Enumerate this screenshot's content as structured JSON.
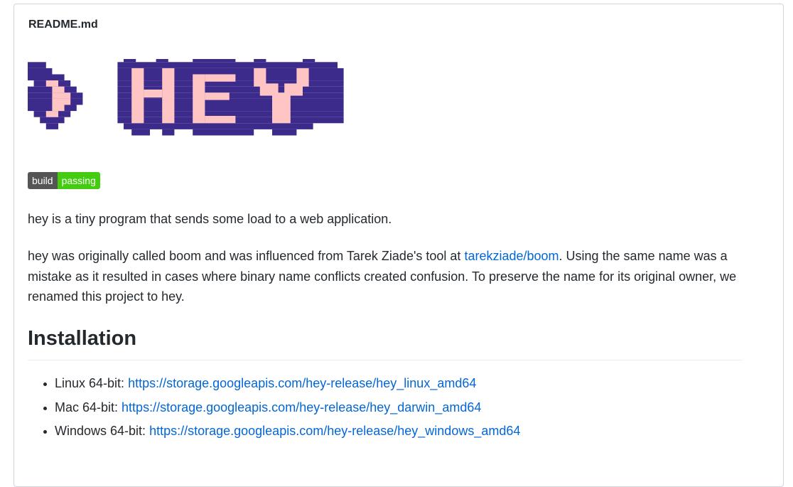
{
  "readme": {
    "filename": "README.md"
  },
  "logo": {
    "alt": "> HEY",
    "colors": {
      "outline": "#3d2b8c",
      "fill": "#ffc4c4"
    }
  },
  "badge": {
    "label": "build",
    "status": "passing",
    "label_color": "#555555",
    "status_color": "#44cc11"
  },
  "intro": {
    "text": "hey is a tiny program that sends some load to a web application."
  },
  "history": {
    "before_link": "hey was originally called boom and was influenced from Tarek Ziade's tool at ",
    "link_text": "tarekziade/boom",
    "after_link": ". Using the same name was a mistake as it resulted in cases where binary name conflicts created confusion. To preserve the name for its original owner, we renamed this project to hey."
  },
  "installation": {
    "heading": "Installation",
    "items": [
      {
        "label": "Linux 64-bit: ",
        "url": "https://storage.googleapis.com/hey-release/hey_linux_amd64"
      },
      {
        "label": "Mac 64-bit: ",
        "url": "https://storage.googleapis.com/hey-release/hey_darwin_amd64"
      },
      {
        "label": "Windows 64-bit: ",
        "url": "https://storage.googleapis.com/hey-release/hey_windows_amd64"
      }
    ]
  },
  "colors": {
    "link": "#0366d6",
    "text": "#24292e",
    "border": "#d1d5da"
  }
}
